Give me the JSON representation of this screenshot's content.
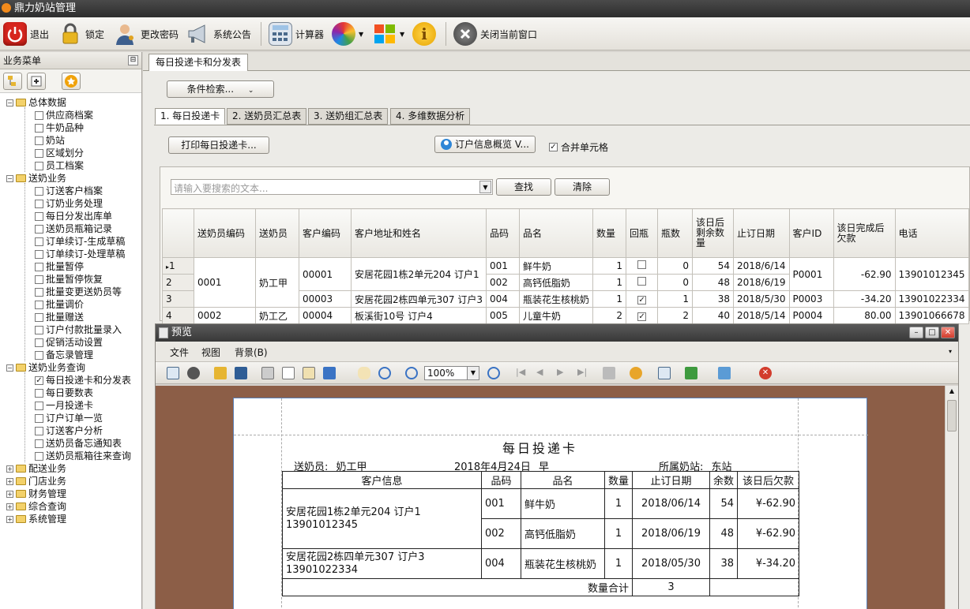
{
  "app": {
    "title": "鼎力奶站管理"
  },
  "toolbar": {
    "exit": "退出",
    "lock": "锁定",
    "change_password": "更改密码",
    "announcement": "系统公告",
    "calculator": "计算器",
    "close_window": "关闭当前窗口"
  },
  "sidebar": {
    "title": "业务菜单",
    "groups": [
      {
        "label": "总体数据",
        "items": [
          "供应商档案",
          "牛奶品种",
          "奶站",
          "区域划分",
          "员工档案"
        ]
      },
      {
        "label": "送奶业务",
        "items": [
          "订送客户档案",
          "订奶业务处理",
          "每日分发出库单",
          "送奶员瓶箱记录",
          "订单续订-生成草稿",
          "订单续订-处理草稿",
          "批量暂停",
          "批量暂停恢复",
          "批量变更送奶员等",
          "批量调价",
          "批量赠送",
          "订户付款批量录入",
          "促销活动设置",
          "备忘录管理"
        ]
      },
      {
        "label": "送奶业务查询",
        "items": [
          "每日投递卡和分发表",
          "每日要数表",
          "一月投递卡",
          "订户订单一览",
          "订送客户分析",
          "送奶员备忘通知表",
          "送奶员瓶箱往来查询"
        ]
      },
      {
        "label": "配送业务",
        "items": []
      },
      {
        "label": "门店业务",
        "items": []
      },
      {
        "label": "财务管理",
        "items": []
      },
      {
        "label": "综合查询",
        "items": []
      },
      {
        "label": "系统管理",
        "items": []
      }
    ],
    "checked_item": "每日投递卡和分发表"
  },
  "main": {
    "doc_tab": "每日投递卡和分发表",
    "filter_button": "条件检索...",
    "tabs": [
      "1. 每日投递卡",
      "2. 送奶员汇总表",
      "3. 送奶组汇总表",
      "4. 多维数据分析"
    ],
    "print_button": "打印每日投递卡...",
    "overview_button": "订户信息概览 V...",
    "merge_cells_label": "合并单元格",
    "search_placeholder": "请输入要搜索的文本...",
    "find_button": "查找",
    "clear_button": "清除",
    "grid": {
      "headers": [
        "送奶员编码",
        "送奶员",
        "客户编码",
        "客户地址和姓名",
        "品码",
        "品名",
        "数量",
        "回瓶",
        "瓶数",
        "该日后剩余数量",
        "止订日期",
        "客户ID",
        "该日完成后欠款",
        "电话"
      ],
      "rows": [
        {
          "idx": "1",
          "courier_code": "0001",
          "courier": "奶工甲",
          "cust_code": "00001",
          "address": "安居花园1栋2单元204 订户1",
          "code": "001",
          "name": "鲜牛奶",
          "qty": "1",
          "ret": false,
          "bottles": "0",
          "remain": "54",
          "stop": "2018/6/14",
          "cid": "P0001",
          "debt": "-62.90",
          "phone": "13901012345"
        },
        {
          "idx": "2",
          "code": "002",
          "name": "高钙低脂奶",
          "qty": "1",
          "ret": false,
          "bottles": "0",
          "remain": "48",
          "stop": "2018/6/19"
        },
        {
          "idx": "3",
          "cust_code": "00003",
          "address": "安居花园2栋四单元307 订户3",
          "code": "004",
          "name": "瓶装花生核桃奶",
          "qty": "1",
          "ret": true,
          "bottles": "1",
          "remain": "38",
          "stop": "2018/5/30",
          "cid": "P0003",
          "debt": "-34.20",
          "phone": "13901022334"
        },
        {
          "idx": "4",
          "courier_code": "0002",
          "courier": "奶工乙",
          "cust_code": "00004",
          "address": "板溪街10号 订户4",
          "code": "005",
          "name": "儿童牛奶",
          "qty": "2",
          "ret": true,
          "bottles": "2",
          "remain": "40",
          "stop": "2018/5/14",
          "cid": "P0004",
          "debt": "80.00",
          "phone": "13901066678"
        }
      ]
    }
  },
  "preview": {
    "title": "预览",
    "menu": [
      "文件",
      "视图",
      "背景(B)"
    ],
    "zoom": "100%",
    "report": {
      "title": "每日投递卡",
      "courier_label": "送奶员:",
      "courier": "奶工甲",
      "date": "2018年4月24日",
      "shift": "早",
      "station_label": "所属奶站:",
      "station": "东站",
      "headers": [
        "客户信息",
        "品码",
        "品名",
        "数量",
        "止订日期",
        "余数",
        "该日后欠款"
      ],
      "customer1": "安居花园1栋2单元204 订户1",
      "phone1": "13901012345",
      "customer2": "安居花园2栋四单元307 订户3",
      "phone2": "13901022334",
      "rows": [
        {
          "code": "001",
          "name": "鲜牛奶",
          "qty": "1",
          "stop": "2018/06/14",
          "rem": "54",
          "debt": "¥-62.90"
        },
        {
          "code": "002",
          "name": "高钙低脂奶",
          "qty": "1",
          "stop": "2018/06/19",
          "rem": "48",
          "debt": "¥-62.90"
        },
        {
          "code": "004",
          "name": "瓶装花生核桃奶",
          "qty": "1",
          "stop": "2018/05/30",
          "rem": "38",
          "debt": "¥-34.20"
        }
      ],
      "total_label": "数量合计",
      "total": "3"
    }
  },
  "colors": {
    "accent": "#3a73c4",
    "exit_red": "#d7261e",
    "folder": "#f3d16a"
  }
}
